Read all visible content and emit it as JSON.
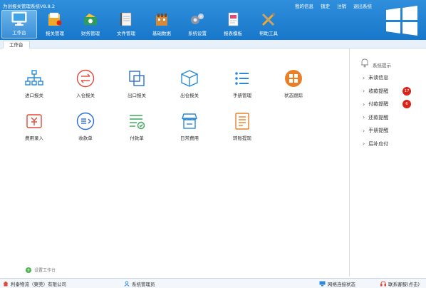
{
  "window": {
    "title": "为创报关管理系统V8.8.2"
  },
  "top_links": [
    "我的信息",
    "锁定",
    "注销",
    "退出系统"
  ],
  "toolbar": [
    {
      "label": "工作台",
      "icon": "monitor-icon",
      "active": true
    },
    {
      "label": "报关管理",
      "icon": "customs-folder-icon"
    },
    {
      "label": "财务管理",
      "icon": "finance-icon"
    },
    {
      "label": "文件管理",
      "icon": "notebook-icon"
    },
    {
      "label": "基础数据",
      "icon": "building-icon"
    },
    {
      "label": "系统设置",
      "icon": "gear-icon"
    },
    {
      "label": "报表模板",
      "icon": "report-icon"
    },
    {
      "label": "帮助工具",
      "icon": "tools-icon"
    }
  ],
  "tabs": [
    "工作台"
  ],
  "tiles": [
    {
      "label": "进口报关",
      "icon": "org-chart-icon",
      "color": "#2a8ad8"
    },
    {
      "label": "入仓报关",
      "icon": "transfer-icon",
      "color": "#e04a3a"
    },
    {
      "label": "出口报关",
      "icon": "copy-icon",
      "color": "#2a6ed8"
    },
    {
      "label": "出仓报关",
      "icon": "box-icon",
      "color": "#2a8ad8"
    },
    {
      "label": "手册管理",
      "icon": "list-icon",
      "color": "#2a8ad8"
    },
    {
      "label": "状态跟踪",
      "icon": "status-grid-icon",
      "color": "#e8802a"
    },
    {
      "label": "费用录入",
      "icon": "yen-input-icon",
      "color": "#e04a3a"
    },
    {
      "label": "收款单",
      "icon": "receipt-icon",
      "color": "#2a6ed8"
    },
    {
      "label": "付款单",
      "icon": "payment-list-icon",
      "color": "#3aa858"
    },
    {
      "label": "日常费用",
      "icon": "shop-icon",
      "color": "#2a8ad8"
    },
    {
      "label": "转账提现",
      "icon": "transfer-doc-icon",
      "color": "#e8802a"
    }
  ],
  "right_panel": {
    "title": "系统提示",
    "items": [
      {
        "label": "未读信息",
        "badge": ""
      },
      {
        "label": "收款提醒",
        "badge": "17"
      },
      {
        "label": "付款提醒",
        "badge": "6"
      },
      {
        "label": "还款提醒",
        "badge": ""
      },
      {
        "label": "手册提醒",
        "badge": ""
      },
      {
        "label": "后补应付",
        "badge": ""
      }
    ]
  },
  "set_workbench": "设置工作台",
  "statusbar": {
    "company": "利泰物流（東莞）有限公司",
    "user": "系统管理员",
    "network": "网络连接状态",
    "support": "联系客服(点击)"
  },
  "colors": {
    "header": "#1877c9",
    "accent": "#2a8ad8",
    "badge": "#d9241b"
  }
}
